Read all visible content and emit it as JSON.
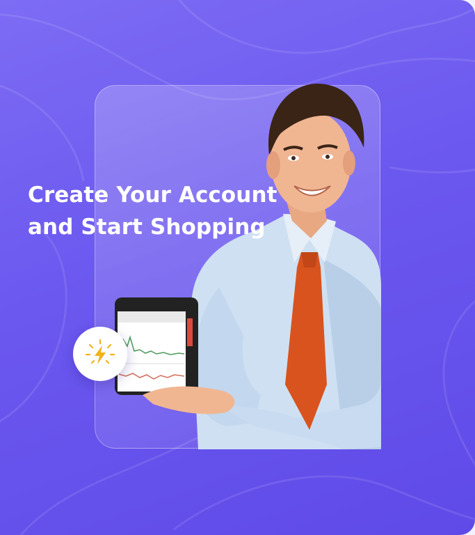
{
  "hero": {
    "headline_line1": "Create Your Account",
    "headline_line2": "and Start Shopping"
  },
  "icons": {
    "badge": "lightning-icon"
  },
  "colors": {
    "background_start": "#7d6cf4",
    "background_end": "#5f4ae8",
    "tie": "#d9531e",
    "shirt": "#cfe0f2",
    "badge_icon": "#f2b21b"
  }
}
